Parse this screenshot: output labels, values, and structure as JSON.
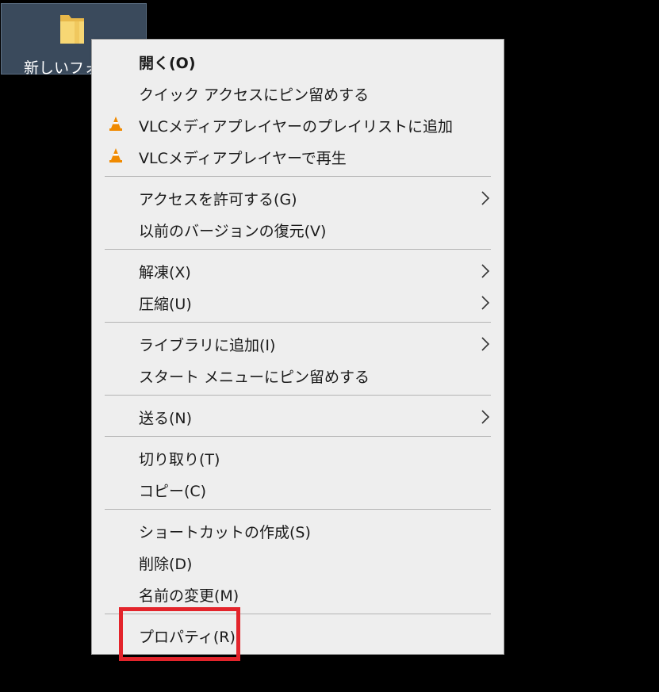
{
  "desktop": {
    "background_color": "#000000",
    "folder_label": "新しいフォル"
  },
  "context_menu": {
    "items": [
      {
        "label": "開く(O)",
        "icon": null,
        "submenu": false,
        "bold": true
      },
      {
        "label": "クイック アクセスにピン留めする",
        "icon": null,
        "submenu": false
      },
      {
        "label": "VLCメディアプレイヤーのプレイリストに追加",
        "icon": "vlc-cone-icon",
        "submenu": false
      },
      {
        "label": "VLCメディアプレイヤーで再生",
        "icon": "vlc-cone-icon",
        "submenu": false
      },
      {
        "label": "アクセスを許可する(G)",
        "icon": null,
        "submenu": true
      },
      {
        "label": "以前のバージョンの復元(V)",
        "icon": null,
        "submenu": false
      },
      {
        "label": "解凍(X)",
        "icon": null,
        "submenu": true
      },
      {
        "label": "圧縮(U)",
        "icon": null,
        "submenu": true
      },
      {
        "label": "ライブラリに追加(I)",
        "icon": null,
        "submenu": true
      },
      {
        "label": "スタート メニューにピン留めする",
        "icon": null,
        "submenu": false
      },
      {
        "label": "送る(N)",
        "icon": null,
        "submenu": true
      },
      {
        "label": "切り取り(T)",
        "icon": null,
        "submenu": false
      },
      {
        "label": "コピー(C)",
        "icon": null,
        "submenu": false
      },
      {
        "label": "ショートカットの作成(S)",
        "icon": null,
        "submenu": false
      },
      {
        "label": "削除(D)",
        "icon": null,
        "submenu": false
      },
      {
        "label": "名前の変更(M)",
        "icon": null,
        "submenu": false
      },
      {
        "label": "プロパティ(R)",
        "icon": null,
        "submenu": false
      }
    ],
    "background_color": "#eeeeee",
    "separator_color": "#b4b4b4"
  },
  "annotation": {
    "highlight_color": "#e3242b",
    "highlighted_item": "プロパティ(R)"
  }
}
